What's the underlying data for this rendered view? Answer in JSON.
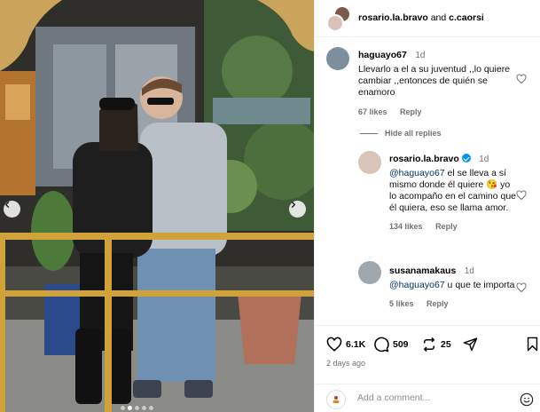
{
  "post": {
    "author": "rosario.la.bravo",
    "and_word": "and",
    "collaborator": "c.caorsi"
  },
  "comments": [
    {
      "username": "haguayo67",
      "time": "1d",
      "text": "Llevarlo a el a su juventud ,,lo quiere cambiar ,,entonces de quién se enamoro",
      "likes": "67 likes",
      "reply_label": "Reply"
    }
  ],
  "hide_replies_label": "Hide all replies",
  "replies": [
    {
      "username": "rosario.la.bravo",
      "verified": true,
      "time": "1d",
      "mention": "@haguayo67",
      "text": " el se lleva a sí mismo donde él quiere 😘 yo lo acompaño en el camino que él quiera, eso se llama amor.",
      "likes": "134 likes",
      "reply_label": "Reply"
    },
    {
      "username": "susanamakaus",
      "time": "1d",
      "mention": "@haguayo67",
      "text": " u que te importa",
      "likes": "5 likes",
      "reply_label": "Reply"
    }
  ],
  "actions": {
    "likes_count": "6.1K",
    "comments_count": "509",
    "reposts_count": "25"
  },
  "posted_ago": "2 days ago",
  "add_comment": {
    "placeholder": "Add a comment..."
  },
  "icons": [
    "heart-icon",
    "comment-icon",
    "repost-icon",
    "share-icon",
    "bookmark-icon",
    "emoji-icon",
    "chevron-left-icon",
    "chevron-right-icon"
  ],
  "colors": {
    "link": "#00376b",
    "verified": "#0095f6",
    "muted": "#737373"
  }
}
